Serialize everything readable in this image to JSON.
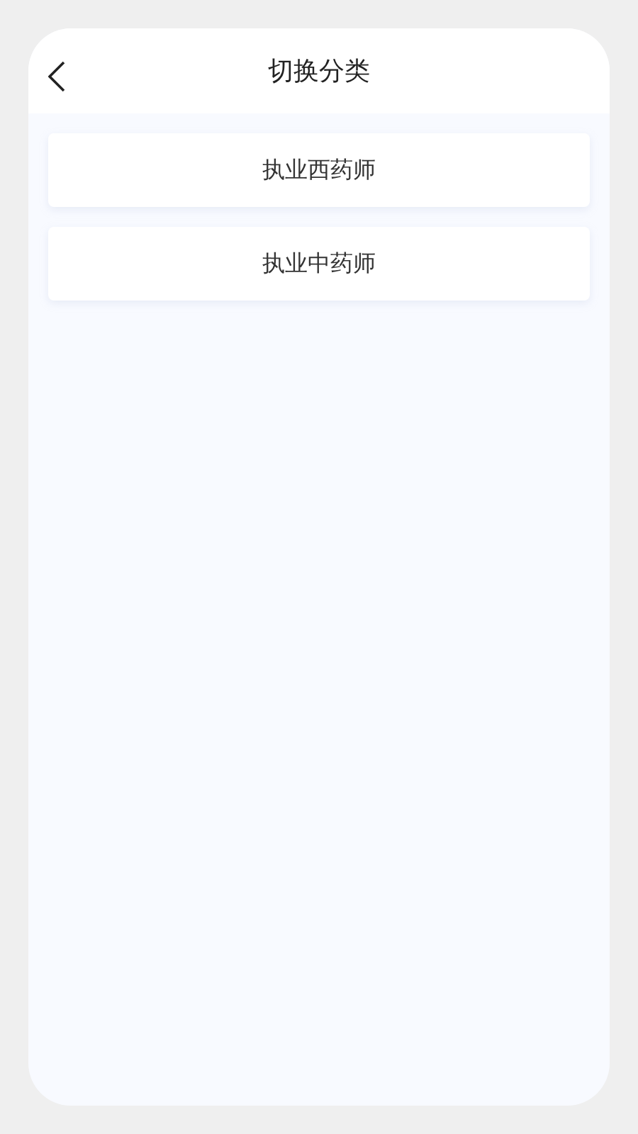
{
  "header": {
    "title": "切换分类"
  },
  "categories": [
    {
      "label": "执业西药师"
    },
    {
      "label": "执业中药师"
    }
  ]
}
